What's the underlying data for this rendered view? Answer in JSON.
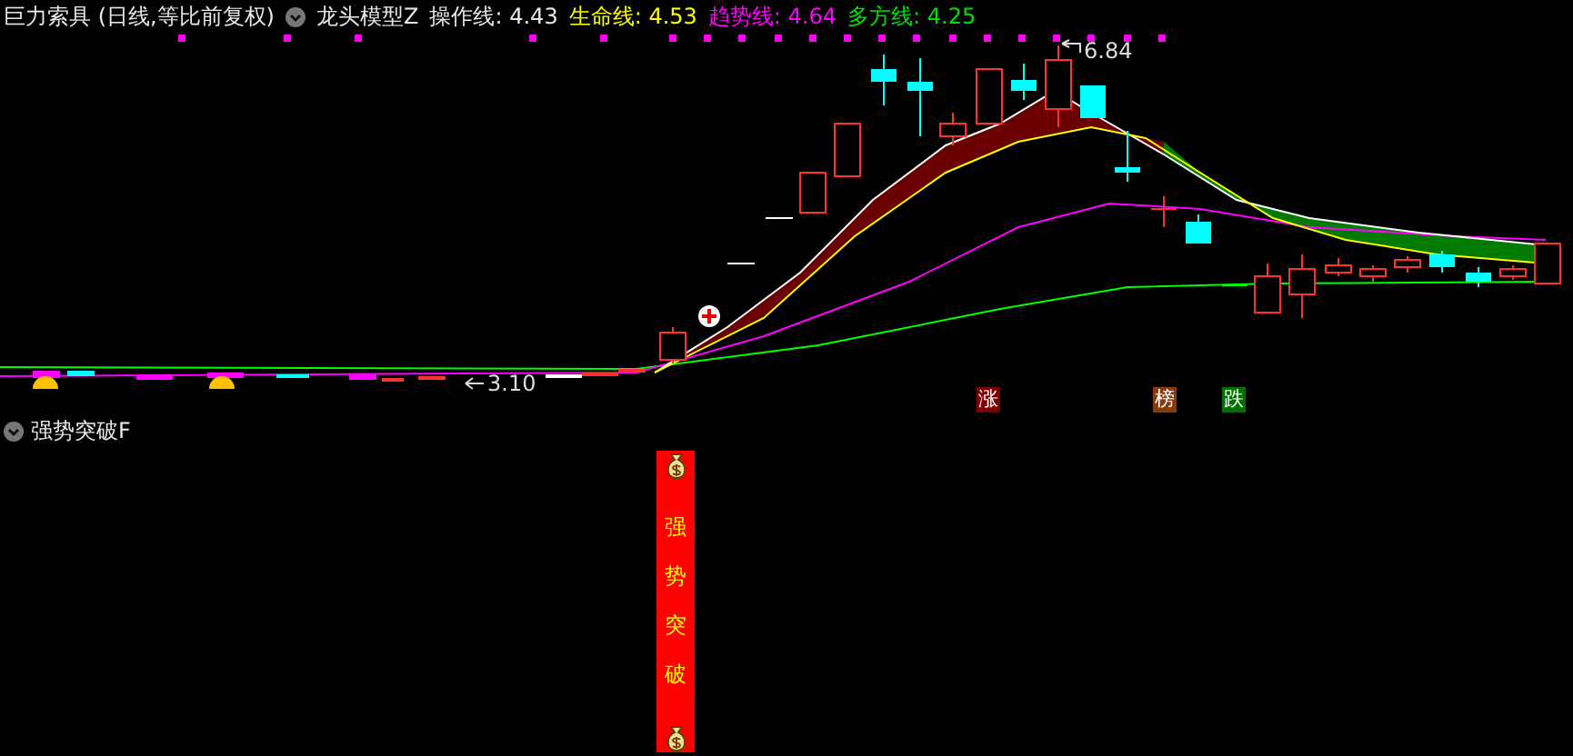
{
  "header": {
    "title": "巨力索具 (日线,等比前复权)",
    "indicator_name": "龙头模型Z",
    "lines": [
      {
        "label": "操作线:",
        "value": "4.43",
        "color": "#e8e8e8"
      },
      {
        "label": "生命线:",
        "value": "4.53",
        "color": "#ffff00"
      },
      {
        "label": "趋势线:",
        "value": "4.64",
        "color": "#ff00ff"
      },
      {
        "label": "多方线:",
        "value": "4.25",
        "color": "#00e000"
      }
    ]
  },
  "main_chart": {
    "high_label": "6.84",
    "low_label": "3.10",
    "tags": [
      {
        "text": "涨",
        "color": "#800000"
      },
      {
        "text": "榜",
        "color": "#8b3a0a"
      },
      {
        "text": "跌",
        "color": "#007000"
      }
    ]
  },
  "sub_panel": {
    "title": "强势突破F",
    "signal_text": "强势突破"
  }
}
